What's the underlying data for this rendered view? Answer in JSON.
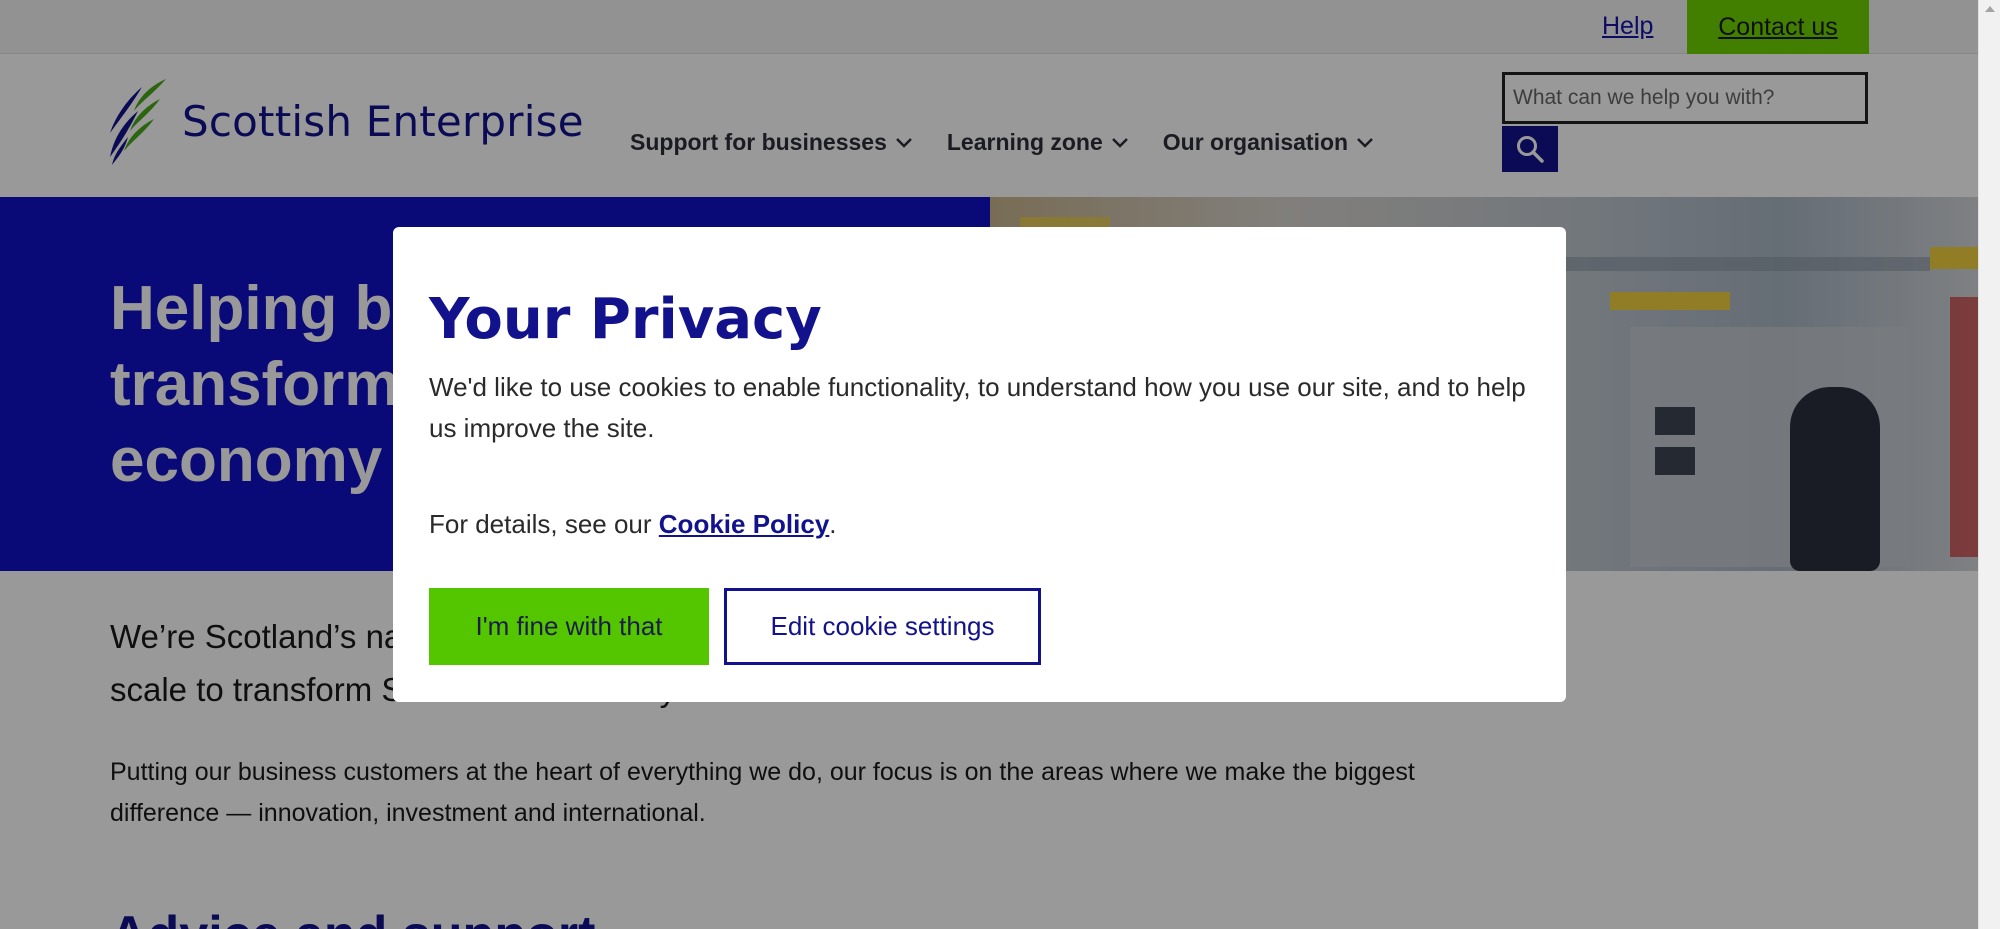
{
  "utility": {
    "help_label": "Help",
    "contact_label": "Contact us"
  },
  "header": {
    "logo_text": "Scottish Enterprise",
    "nav": [
      {
        "label": "Support for businesses"
      },
      {
        "label": "Learning zone"
      },
      {
        "label": "Our organisation"
      }
    ],
    "search_placeholder": "What can we help you with?"
  },
  "hero": {
    "title": "Helping businesses transform Scotland's economy"
  },
  "intro": {
    "lead": "We’re Scotland’s national economic development agency. We help businesses innovate and scale to transform Scotland’s economy.",
    "body": "Putting our business customers at the heart of everything we do, our focus is on the areas where we make the biggest difference — innovation, investment and international."
  },
  "section": {
    "heading": "Advice and support"
  },
  "cookie_modal": {
    "title": "Your Privacy",
    "body": "We'd like to use cookies to enable functionality, to understand how you use our site, and to help us improve the site.",
    "details_prefix": "For details, see our ",
    "details_link": "Cookie Policy",
    "details_suffix": ".",
    "accept_label": "I'm fine with that",
    "edit_label": "Edit cookie settings"
  },
  "colors": {
    "brand_navy": "#12138c",
    "hero_blue": "#1010c8",
    "accent_green": "#54c600",
    "contact_green": "#6fd300"
  }
}
